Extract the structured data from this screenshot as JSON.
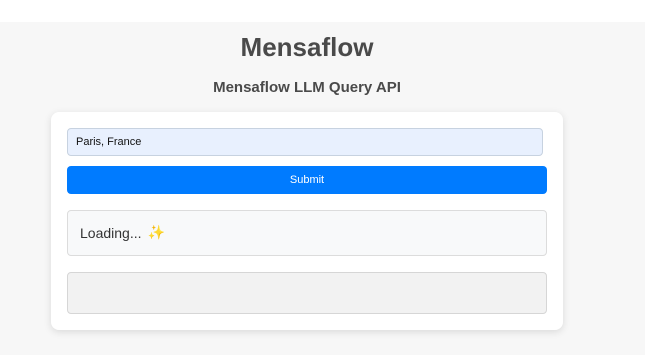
{
  "app": {
    "title": "Mensaflow",
    "subtitle": "Mensaflow LLM Query API"
  },
  "form": {
    "query_value": "Paris, France",
    "submit_label": "Submit"
  },
  "status": {
    "text": "Loading...",
    "icon": "sparkles-icon",
    "glyph": "✨"
  },
  "response": {
    "text": ""
  },
  "colors": {
    "accent": "#007bff",
    "input_bg": "#e8f0fe",
    "page_bg": "#f7f7f7"
  }
}
